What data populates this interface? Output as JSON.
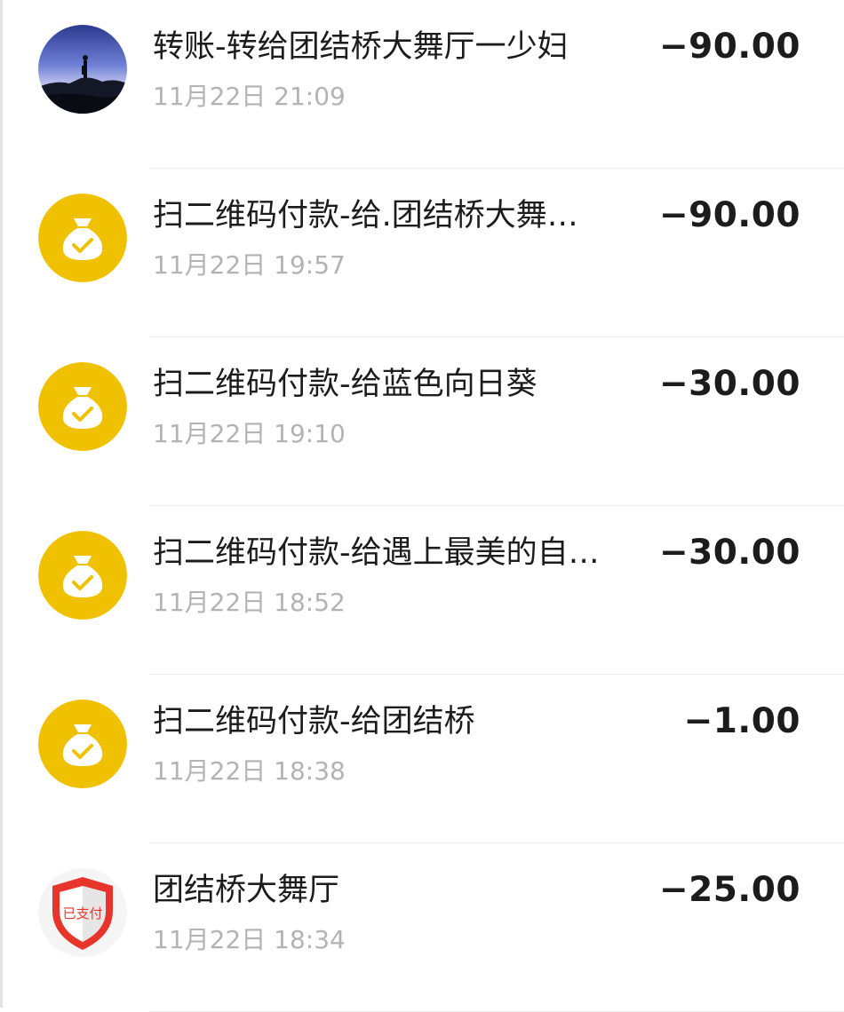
{
  "transactions": [
    {
      "title": "转账-转给团结桥大舞厅一少妇",
      "time": "11月22日 21:09",
      "amount": "−90.00",
      "icon": "profile-photo-avatar"
    },
    {
      "title": "扫二维码付款-给.团结桥大舞…",
      "time": "11月22日 19:57",
      "amount": "−90.00",
      "icon": "money-bag-check-icon"
    },
    {
      "title": "扫二维码付款-给蓝色向日葵",
      "time": "11月22日 19:10",
      "amount": "−30.00",
      "icon": "money-bag-check-icon"
    },
    {
      "title": "扫二维码付款-给遇上最美的自…",
      "time": "11月22日 18:52",
      "amount": "−30.00",
      "icon": "money-bag-check-icon"
    },
    {
      "title": "扫二维码付款-给团结桥",
      "time": "11月22日 18:38",
      "amount": "−1.00",
      "icon": "money-bag-check-icon"
    },
    {
      "title": "团结桥大舞厅",
      "time": "11月22日 18:34",
      "amount": "−25.00",
      "icon": "paid-shield-icon",
      "icon_text": "已支付"
    }
  ],
  "colors": {
    "bag_yellow": "#EFC100",
    "shield_red": "#E8352B",
    "amount_text": "#1C1C1C",
    "time_text": "#B3B3B3"
  }
}
